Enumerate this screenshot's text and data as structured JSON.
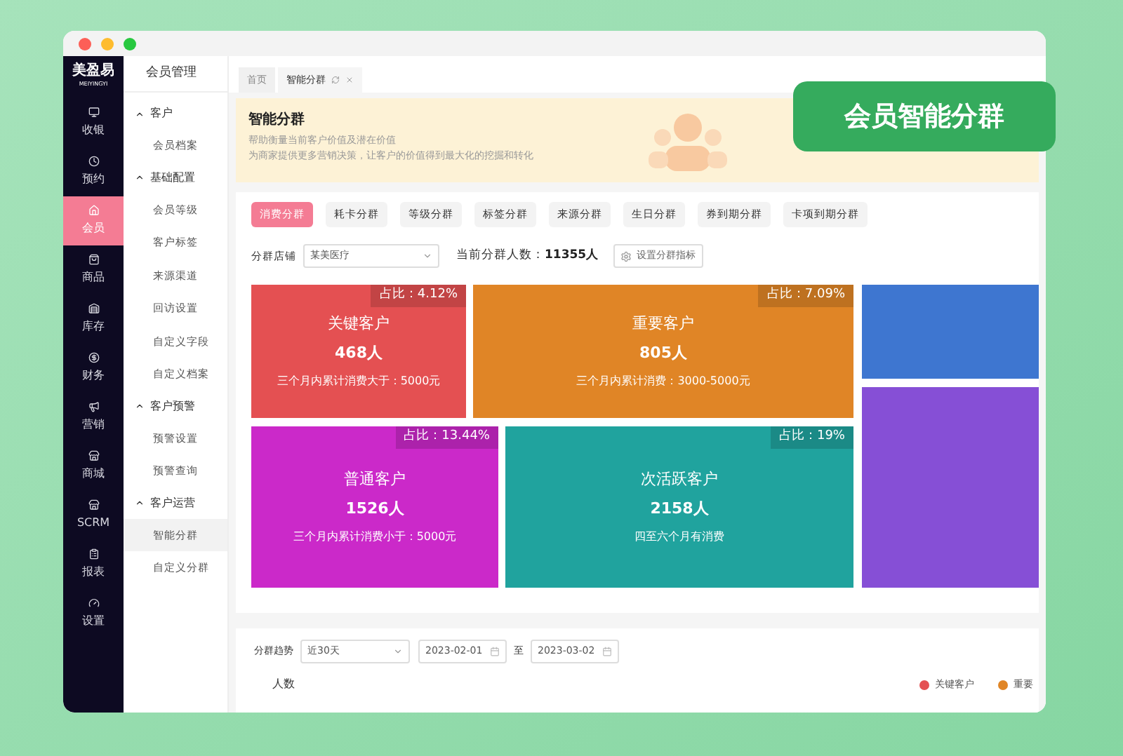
{
  "logo": {
    "name": "美盈易",
    "subtitle": "MEIYINGYI"
  },
  "nav": [
    {
      "label": "收银",
      "selected": false
    },
    {
      "label": "预约",
      "selected": false
    },
    {
      "label": "会员",
      "selected": true
    },
    {
      "label": "商品",
      "selected": false
    },
    {
      "label": "库存",
      "selected": false
    },
    {
      "label": "财务",
      "selected": false
    },
    {
      "label": "营销",
      "selected": false
    },
    {
      "label": "商城",
      "selected": false
    },
    {
      "label": "SCRM",
      "selected": false
    },
    {
      "label": "报表",
      "selected": false
    },
    {
      "label": "设置",
      "selected": false
    }
  ],
  "submenu": {
    "title": "会员管理",
    "groups": [
      {
        "label": "客户",
        "expanded": true,
        "children": [
          {
            "label": "会员档案",
            "selected": false
          }
        ]
      },
      {
        "label": "基础配置",
        "expanded": true,
        "children": [
          {
            "label": "会员等级",
            "selected": false
          },
          {
            "label": "客户标签",
            "selected": false
          },
          {
            "label": "来源渠道",
            "selected": false
          },
          {
            "label": "回访设置",
            "selected": false
          },
          {
            "label": "自定义字段",
            "selected": false
          },
          {
            "label": "自定义档案",
            "selected": false
          }
        ]
      },
      {
        "label": "客户预警",
        "expanded": true,
        "children": [
          {
            "label": "预警设置",
            "selected": false
          },
          {
            "label": "预警查询",
            "selected": false
          }
        ]
      },
      {
        "label": "客户运营",
        "expanded": true,
        "children": [
          {
            "label": "智能分群",
            "selected": true
          },
          {
            "label": "自定义分群",
            "selected": false
          }
        ]
      }
    ]
  },
  "page_tabs": [
    {
      "label": "首页",
      "selected": false,
      "closable": false
    },
    {
      "label": "智能分群",
      "selected": true,
      "closable": true
    }
  ],
  "banner": {
    "title": "智能分群",
    "lines": [
      "帮助衡量当前客户价值及潜在价值",
      "为商家提供更多营销决策，让客户的价值得到最大化的挖掘和转化"
    ]
  },
  "badge": "会员智能分群",
  "segment_tabs": [
    {
      "label": "消费分群",
      "selected": true
    },
    {
      "label": "耗卡分群",
      "selected": false
    },
    {
      "label": "等级分群",
      "selected": false
    },
    {
      "label": "标签分群",
      "selected": false
    },
    {
      "label": "来源分群",
      "selected": false
    },
    {
      "label": "生日分群",
      "selected": false
    },
    {
      "label": "券到期分群",
      "selected": false
    },
    {
      "label": "卡项到期分群",
      "selected": false
    }
  ],
  "filter": {
    "store_label": "分群店铺",
    "store_value": "某美医疗",
    "count_label": "当前分群人数：",
    "count_value": "11355人",
    "settings_button": "设置分群指标"
  },
  "groups": [
    {
      "name": "关键客户",
      "count": "468人",
      "desc": "三个月内累计消费大于：5000元",
      "ratio": "占比：4.12%",
      "color": "#e45052"
    },
    {
      "name": "重要客户",
      "count": "805人",
      "desc": "三个月内累计消费：3000-5000元",
      "ratio": "占比：7.09%",
      "color": "#e08526"
    },
    {
      "name": "普通客户",
      "count": "1526人",
      "desc": "三个月内累计消费小于：5000元",
      "ratio": "占比：13.44%",
      "color": "#cb29c9"
    },
    {
      "name": "次活跃客户",
      "count": "2158人",
      "desc": "四至六个月有消费",
      "ratio": "占比：19%",
      "color": "#20a39e"
    },
    {
      "color": "#3e76d0"
    },
    {
      "color": "#864fd6"
    }
  ],
  "trend": {
    "label": "分群趋势",
    "range": "近30天",
    "start": "2023-02-01",
    "separator": "至",
    "end": "2023-03-02",
    "ylabel": "人数",
    "legend": [
      {
        "label": "关键客户",
        "color": "#e45052"
      },
      {
        "label": "重要",
        "color": "#e08526"
      }
    ]
  }
}
